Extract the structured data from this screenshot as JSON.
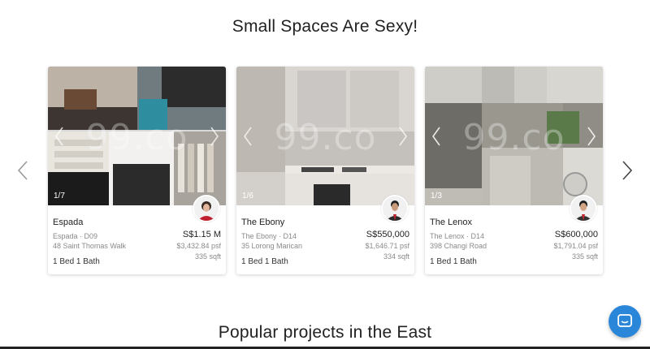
{
  "sections": {
    "featured_title": "Small Spaces Are Sexy!",
    "next_title": "Popular projects in the East"
  },
  "watermark": "99.co",
  "colors": {
    "chat_button": "#2a86d9",
    "card_bg": "#ffffff",
    "title": "#222222"
  },
  "icons": {
    "carousel_prev": "chevron-left-icon",
    "carousel_next": "chevron-right-icon",
    "chat": "chat-bubble-icon"
  },
  "listings": [
    {
      "name": "Espada",
      "district": "Espada · D09",
      "address": "48 Saint Thomas Walk",
      "price": "S$1.15 M",
      "psf": "$3,432.84 psf",
      "size": "335 sqft",
      "rooms": "1 Bed 1 Bath",
      "photo_counter": "1/7"
    },
    {
      "name": "The Ebony",
      "district": "The Ebony · D14",
      "address": "35 Lorong Marican",
      "price": "S$550,000",
      "psf": "$1,646.71 psf",
      "size": "334 sqft",
      "rooms": "1 Bed 1 Bath",
      "photo_counter": "1/6"
    },
    {
      "name": "The Lenox",
      "district": "The Lenox · D14",
      "address": "398 Changi Road",
      "price": "S$600,000",
      "psf": "$1,791.04 psf",
      "size": "335 sqft",
      "rooms": "1 Bed 1 Bath",
      "photo_counter": "1/3"
    }
  ]
}
